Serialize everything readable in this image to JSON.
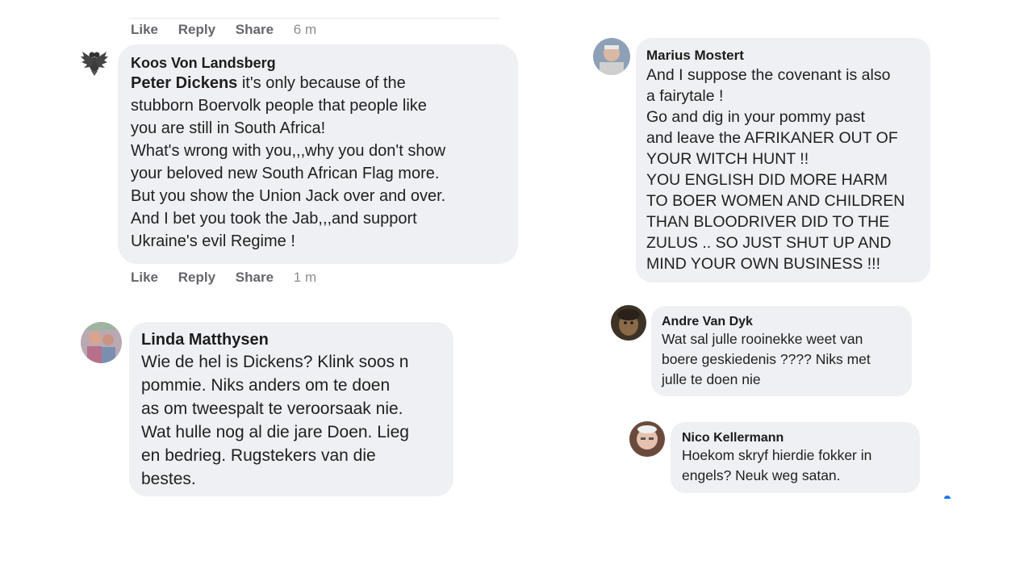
{
  "left": {
    "top_actions": {
      "like": "Like",
      "reply": "Reply",
      "share": "Share",
      "time": "6 m"
    },
    "comment1": {
      "author": "Koos Von Landsberg",
      "mention": "Peter Dickens",
      "text": " it's only because of the\nstubborn Boervolk people that people like\nyou are still in South Africa!\nWhat's wrong with you,,,why you don't show\nyour beloved new South African Flag more.\nBut you show the Union Jack over and over.\nAnd I bet you took the Jab,,,and support\nUkraine's evil Regime !",
      "actions": {
        "like": "Like",
        "reply": "Reply",
        "share": "Share",
        "time": "1 m"
      }
    },
    "comment2": {
      "author": "Linda Matthysen",
      "text": "Wie de hel is Dickens? Klink soos n\npommie. Niks anders om te doen\nas om tweespalt te veroorsaak nie.\nWat hulle nog al die jare Doen. Lieg\nen bedrieg. Rugstekers van die\nbestes."
    }
  },
  "right": {
    "comment1": {
      "author": "Marius Mostert",
      "text": "And I suppose the covenant is also\na fairytale !\n  Go and dig in your pommy past\nand leave the AFRIKANER OUT OF\nYOUR WITCH HUNT !!\n  YOU ENGLISH DID MORE HARM\nTO BOER WOMEN AND CHILDREN\nTHAN BLOODRIVER DID TO THE\nZULUS .. SO JUST SHUT UP AND\nMIND YOUR OWN BUSINESS !!!"
    },
    "comment2": {
      "author": "Andre Van Dyk",
      "text": "Wat sal julle rooinekke weet van\nboere geskiedenis ???? Niks met\njulle te doen nie"
    },
    "comment3": {
      "author": "Nico Kellermann",
      "text": "Hoekom skryf hierdie fokker in\nengels? Neuk weg satan."
    }
  }
}
